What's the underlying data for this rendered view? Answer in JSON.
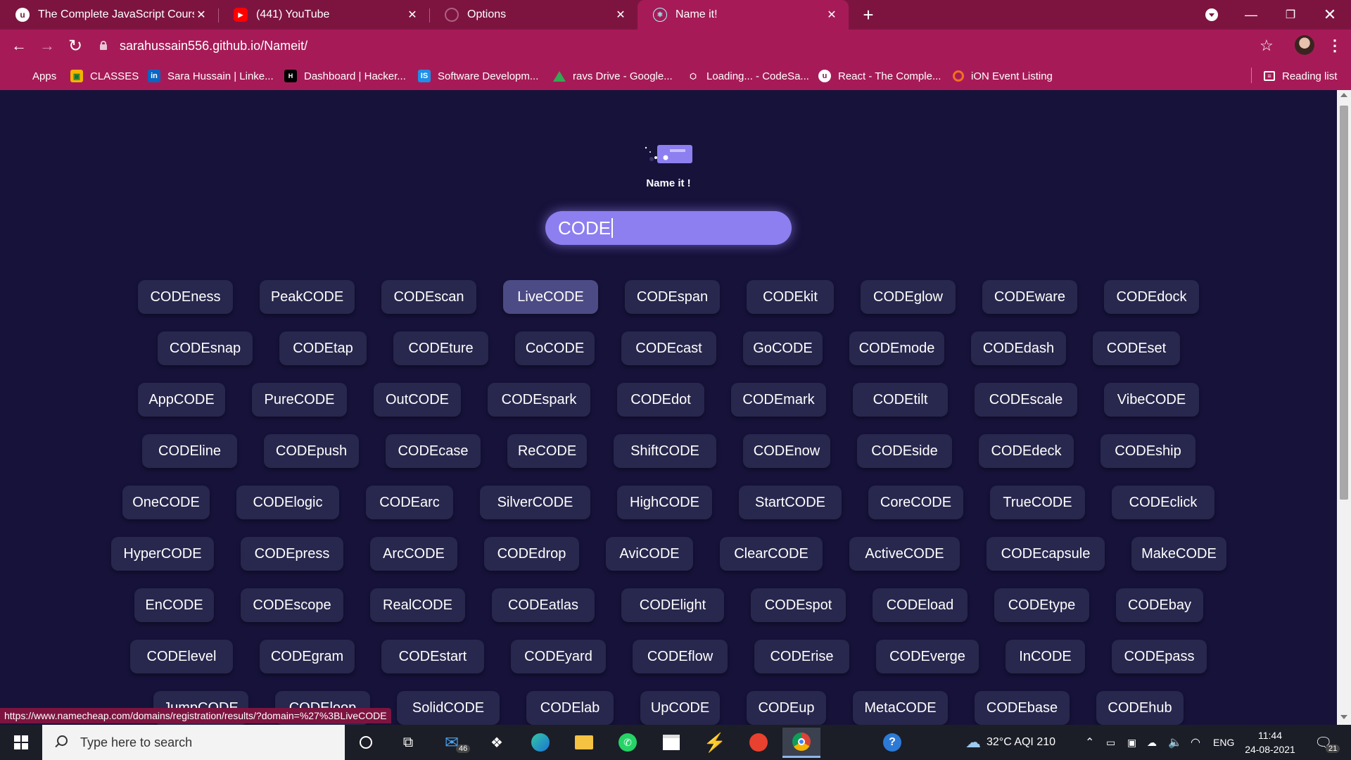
{
  "browser": {
    "tabs": [
      {
        "title": "The Complete JavaScript Course",
        "icon": "udemy-icon"
      },
      {
        "title": "(441) YouTube",
        "icon": "youtube-icon"
      },
      {
        "title": "Options",
        "icon": "github-icon"
      },
      {
        "title": "Name it!",
        "icon": "react-icon"
      }
    ],
    "url": "sarahussain556.github.io/Nameit/",
    "bookmarks": [
      {
        "label": "Apps",
        "icon": "apps-grid-icon"
      },
      {
        "label": "CLASSES",
        "icon": "classroom-icon"
      },
      {
        "label": "Sara Hussain | Linke...",
        "icon": "linkedin-icon"
      },
      {
        "label": "Dashboard | Hacker...",
        "icon": "hackerrank-icon"
      },
      {
        "label": "Software Developm...",
        "icon": "is-icon"
      },
      {
        "label": "ravs Drive - Google...",
        "icon": "google-drive-icon"
      },
      {
        "label": "Loading... - CodeSa...",
        "icon": "codesandbox-icon"
      },
      {
        "label": "React - The Comple...",
        "icon": "udemy-icon"
      },
      {
        "label": "iON Event Listing",
        "icon": "ion-icon"
      }
    ],
    "reading_list": "Reading list",
    "status_url": "https://www.namecheap.com/domains/registration/results/?domain=%27%3BLiveCODE",
    "accent": "#a61b57"
  },
  "app": {
    "title": "Name it !",
    "input_value": "CODE",
    "names": [
      [
        "CODEness",
        "PeakCODE",
        "CODEscan",
        "LiveCODE",
        "CODEspan",
        "CODEkit",
        "CODEglow",
        "CODEware",
        "CODEdock"
      ],
      [
        "CODEsnap",
        "CODEtap",
        "CODEture",
        "CoCODE",
        "CODEcast",
        "GoCODE",
        "CODEmode",
        "CODEdash",
        "CODEset"
      ],
      [
        "AppCODE",
        "PureCODE",
        "OutCODE",
        "CODEspark",
        "CODEdot",
        "CODEmark",
        "CODEtilt",
        "CODEscale",
        "VibeCODE"
      ],
      [
        "CODEline",
        "CODEpush",
        "CODEcase",
        "ReCODE",
        "ShiftCODE",
        "CODEnow",
        "CODEside",
        "CODEdeck",
        "CODEship"
      ],
      [
        "OneCODE",
        "CODElogic",
        "CODEarc",
        "SilverCODE",
        "HighCODE",
        "StartCODE",
        "CoreCODE",
        "TrueCODE",
        "CODEclick"
      ],
      [
        "HyperCODE",
        "CODEpress",
        "ArcCODE",
        "CODEdrop",
        "AviCODE",
        "ClearCODE",
        "ActiveCODE",
        "CODEcapsule",
        "MakeCODE"
      ],
      [
        "EnCODE",
        "CODEscope",
        "RealCODE",
        "CODEatlas",
        "CODElight",
        "CODEspot",
        "CODEload",
        "CODEtype",
        "CODEbay"
      ],
      [
        "CODElevel",
        "CODEgram",
        "CODEstart",
        "CODEyard",
        "CODEflow",
        "CODErise",
        "CODEverge",
        "InCODE",
        "CODEpass"
      ],
      [
        "JumpCODE",
        "CODEloop",
        "SolidCODE",
        "CODElab",
        "UpCODE",
        "CODEup",
        "MetaCODE",
        "CODEbase",
        "CODEhub"
      ]
    ],
    "hovered": "LiveCODE",
    "background": "#16123a",
    "chip_color": "#28274d",
    "input_color": "#8d7ff0"
  },
  "taskbar": {
    "search_placeholder": "Type here to search",
    "mail_badge": "46",
    "weather": "32°C  AQI 210",
    "language": "ENG",
    "time": "11:44",
    "date": "24-08-2021",
    "notifications": "21"
  }
}
